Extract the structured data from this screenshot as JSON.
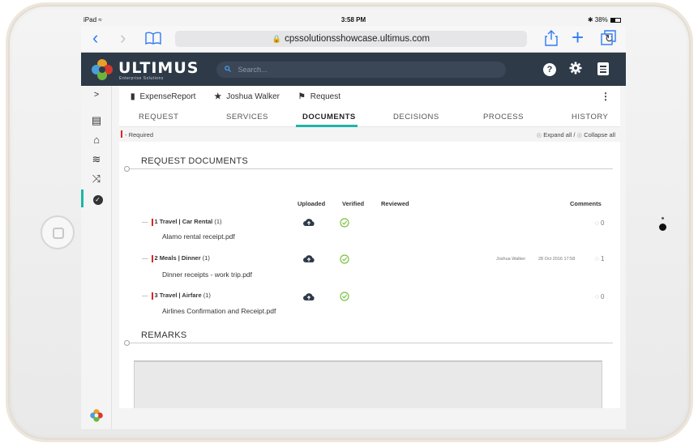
{
  "status_bar": {
    "device": "iPad",
    "wifi_icon": "wifi-icon",
    "time": "3:58 PM",
    "battery": "38%"
  },
  "browser": {
    "url": "cpssolutionsshowcase.ultimus.com",
    "back_icon": "chevron-left-icon",
    "forward_icon": "chevron-right-icon",
    "bookmarks_icon": "book-icon",
    "reload_icon": "reload-icon",
    "share_icon": "share-icon",
    "new_tab_icon": "plus-icon",
    "tabs_icon": "tabs-icon"
  },
  "app_header": {
    "logo_name": "ULTIMUS",
    "logo_sub": "Enterprise Solutions",
    "search_placeholder": "Search...",
    "help_label": "?",
    "settings_icon": "gear-icon",
    "menu_icon": "menu-icon"
  },
  "sidebar": {
    "toggle": ">",
    "items": [
      "task-icon",
      "inbox-icon",
      "layers-icon",
      "shuffle-icon",
      "check-circle-icon"
    ],
    "active_index": 4
  },
  "breadcrumb": {
    "items": [
      {
        "icon": "form-icon",
        "label": "ExpenseReport"
      },
      {
        "icon": "star-icon",
        "label": "Joshua Walker"
      },
      {
        "icon": "flag-icon",
        "label": "Request"
      }
    ],
    "more_icon": "kebab-icon"
  },
  "tabs": [
    {
      "label": "REQUEST"
    },
    {
      "label": "SERVICES"
    },
    {
      "label": "DOCUMENTS",
      "active": true
    },
    {
      "label": "DECISIONS"
    },
    {
      "label": "PROCESS"
    },
    {
      "label": "HISTORY"
    }
  ],
  "required_note": "- Required",
  "expand_collapse": {
    "expand": "Expand all",
    "separator": " / ",
    "collapse": "Collapse all"
  },
  "documents_section": {
    "title": "REQUEST DOCUMENTS",
    "columns": {
      "uploaded": "Uploaded",
      "verified": "Verified",
      "reviewed": "Reviewed",
      "comments": "Comments"
    },
    "rows": [
      {
        "number": "1",
        "title": "Travel | Car Rental",
        "count": "(1)",
        "file": "Alamo rental receipt.pdf",
        "comment_author": "",
        "comment_date": "",
        "comment_count": "0"
      },
      {
        "number": "2",
        "title": "Meals | Dinner",
        "count": "(1)",
        "file": "Dinner receipts - work trip.pdf",
        "comment_author": "Joshua Walker",
        "comment_date": "28 Oct 2016 17:58",
        "comment_count": "1"
      },
      {
        "number": "3",
        "title": "Travel | Airfare",
        "count": "(1)",
        "file": "Airlines Confirmation and Receipt.pdf",
        "comment_author": "",
        "comment_date": "",
        "comment_count": "0"
      }
    ]
  },
  "remarks_section": {
    "title": "REMARKS",
    "value": ""
  },
  "colors": {
    "header_bg": "#2e3a48",
    "accent": "#1fb5a8",
    "required": "#d9262a",
    "verified": "#7bc043",
    "link_blue": "#2f7cf6"
  }
}
